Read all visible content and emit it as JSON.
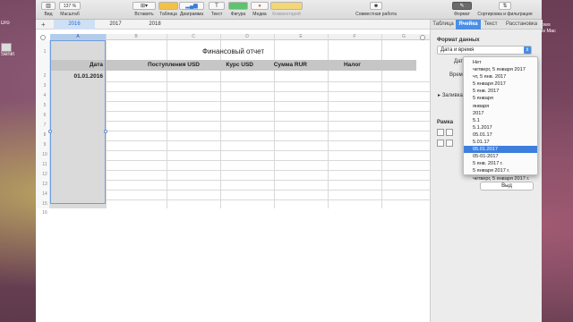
{
  "desktop": {
    "icons": [
      {
        "label": "Dro"
      },
      {
        "label": "Senin"
      }
    ],
    "right_text": [
      "ows",
      "ls Mac"
    ]
  },
  "toolbar": {
    "view_label": "Вид",
    "zoom_value": "137 %",
    "zoom_label": "Масштаб",
    "insert_label": "Вставить",
    "table_label": "Таблица",
    "chart_label": "Диаграмма",
    "text_label": "Текст",
    "shape_label": "Фигура",
    "media_label": "Медиа",
    "comment_label": "Комментарий",
    "collab_label": "Совместная работа",
    "format_label": "Формат",
    "sort_label": "Сортировка и фильтрация"
  },
  "sheets": {
    "add": "+",
    "tabs": [
      "2016",
      "2017",
      "2018"
    ],
    "active_index": 0
  },
  "grid": {
    "columns": [
      "A",
      "B",
      "C",
      "D",
      "E",
      "F",
      "G"
    ],
    "rows": [
      "1",
      "2",
      "3",
      "4",
      "5",
      "6",
      "7",
      "8",
      "9",
      "10",
      "11",
      "12",
      "13",
      "14",
      "15",
      "16"
    ],
    "title": "Финансовый отчет",
    "headers": [
      "Дата",
      "Поступления USD",
      "Курс USD",
      "Сумма RUR",
      "Налог"
    ],
    "first_date": "01.01.2016"
  },
  "sidebar": {
    "tabs": [
      "Таблица",
      "Ячейка",
      "Текст",
      "Расстановка"
    ],
    "active_tab": 1,
    "data_format_label": "Формат данных",
    "data_format_value": "Дата и время",
    "date_label": "Дата",
    "time_label": "Время",
    "fill_label": "Заливка",
    "border_label": "Рамка",
    "button_label": "Выд"
  },
  "date_dropdown": {
    "items": [
      "Нет",
      "четверг, 5 января 2017",
      "чт, 5 янв. 2017",
      "5 января 2017",
      "5 янв. 2017",
      "5 января",
      "января",
      "2017",
      "5.1",
      "5.1.2017",
      "05.01.17",
      "5.01.17",
      "05.01.2017",
      "05-01-2017",
      "5 янв. 2017 г.",
      "5 января 2017 г.",
      "четверг, 5 января 2017 г."
    ],
    "selected_index": 12,
    "highlight_color": "#3e7fdd"
  },
  "colors": {
    "accent": "#4a8ee6",
    "header_row": "#c6c6c6",
    "active_sheet": "#cfe0f5"
  }
}
